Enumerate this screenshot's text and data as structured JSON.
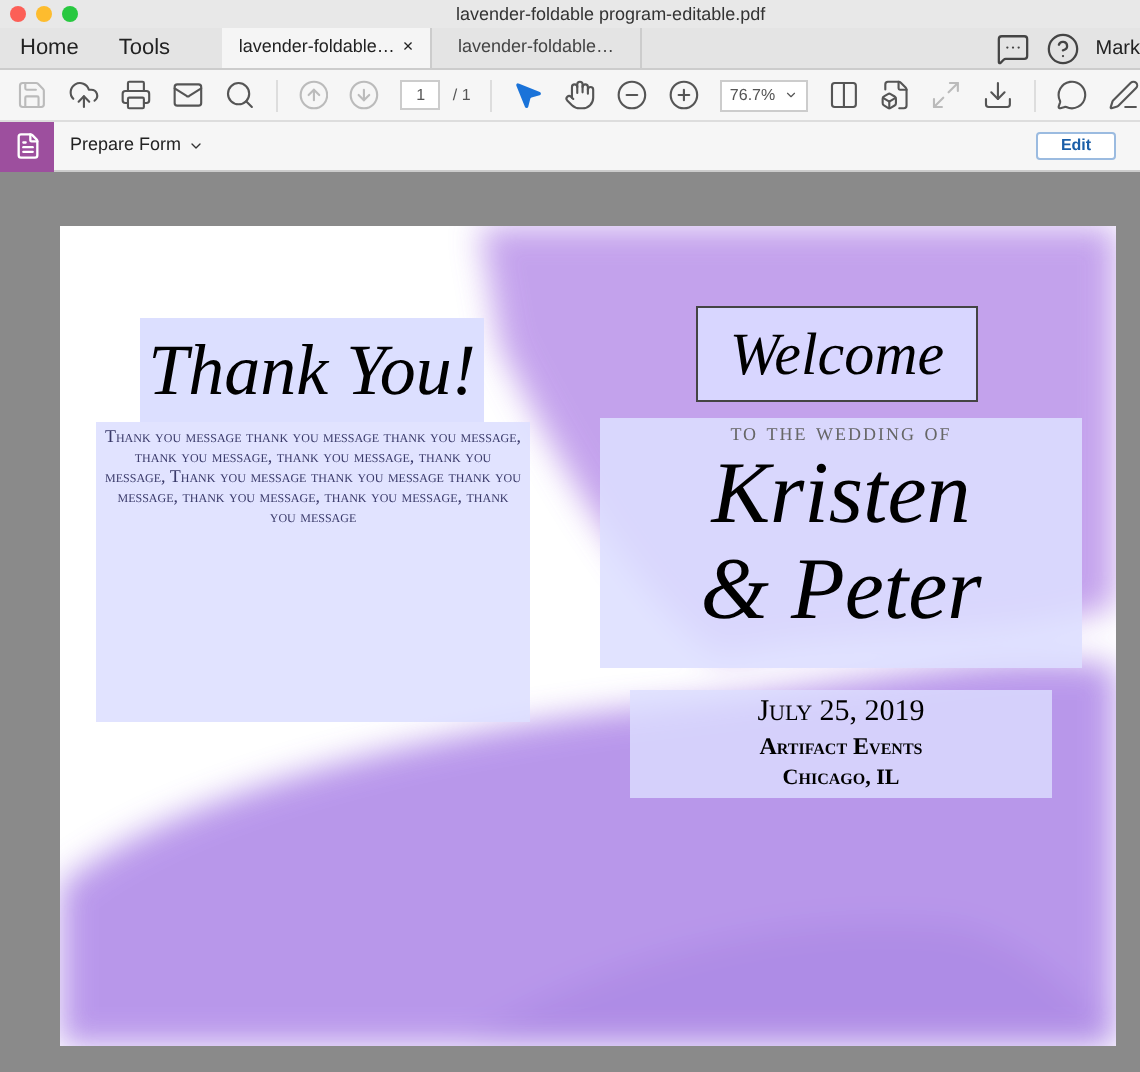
{
  "window": {
    "title": "lavender-foldable program-editable.pdf"
  },
  "nav": [
    {
      "label": "Home"
    },
    {
      "label": "Tools"
    }
  ],
  "tabs": [
    {
      "label": "lavender-foldable…",
      "selected": true,
      "close": "×"
    },
    {
      "label": "lavender-foldable…",
      "selected": false
    }
  ],
  "user": {
    "name": "Mark"
  },
  "toolbar": {
    "page": "1",
    "page_total": "/ 1",
    "zoom": "76.7%"
  },
  "form_bar": {
    "title": "Prepare Form",
    "button": "Edit"
  },
  "document": {
    "left": {
      "heading": "Thank You!",
      "message": "Thank you message thank you message thank you message, thank you message, thank you message, thank you message, Thank you message thank you message thank you message, thank you message, thank you message, thank you message"
    },
    "right": {
      "welcome": "Welcome",
      "subtitle": "to the wedding of",
      "name_1": "Kristen",
      "name_2": "& Peter",
      "date": "July 25, 2019",
      "venue": "Artifact Events",
      "city": "Chicago, IL"
    }
  }
}
